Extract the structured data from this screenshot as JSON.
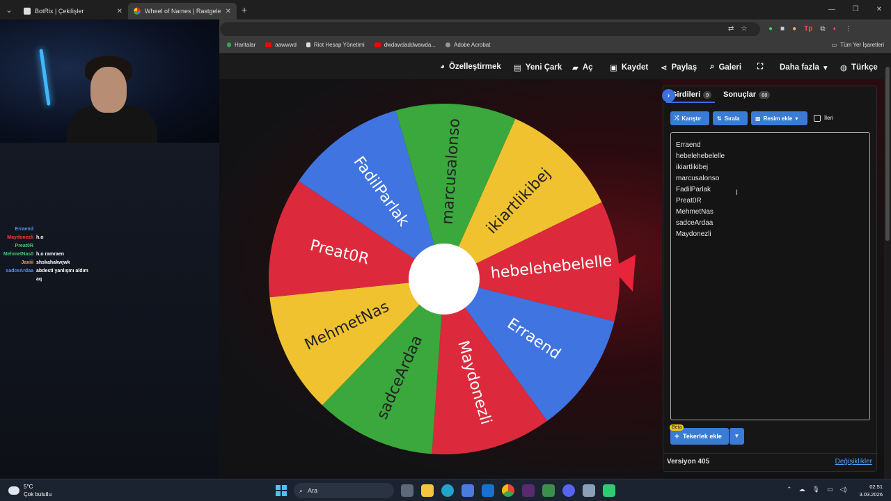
{
  "browser": {
    "tabs": [
      {
        "title": "BotRix | Çekilişler",
        "active": false
      },
      {
        "title": "Wheel of Names | Rastgele ad s",
        "active": true
      }
    ],
    "bookmarks": [
      "Haritalar",
      "aawwwd",
      "Riot Hesap Yönetimi",
      "dwdawdaddwawda...",
      "Adobe Acrobat"
    ],
    "all_bookmarks": "Tüm Yer İşaretleri"
  },
  "nav": {
    "customize": "Özelleştirmek",
    "new_wheel": "Yeni Çark",
    "open": "Aç",
    "save": "Kaydet",
    "share": "Paylaş",
    "gallery": "Galeri",
    "more": "Daha fazla",
    "language": "Türkçe"
  },
  "wheel": {
    "segments": [
      {
        "label": "hebelehebelelle",
        "color": "#dc2a3c"
      },
      {
        "label": "Erraend",
        "color": "#3f74e1"
      },
      {
        "label": "Maydonezli",
        "color": "#dc2a3c"
      },
      {
        "label": "sadceArdaa",
        "color": "#3aa83c"
      },
      {
        "label": "MehmetNas",
        "color": "#f1c230"
      },
      {
        "label": "Preat0R",
        "color": "#dc2a3c"
      },
      {
        "label": "FadilParlak",
        "color": "#3f74e1"
      },
      {
        "label": "marcusalonso",
        "color": "#3aa83c"
      },
      {
        "label": "ikiartlikibej",
        "color": "#f1c230"
      }
    ],
    "pointer_color": "#e8243a"
  },
  "panel": {
    "tab_entries": "Girdileri",
    "tab_entries_count": "9",
    "tab_results": "Sonuçlar",
    "tab_results_count": "60",
    "shuffle": "Karıştır",
    "sort": "Sırala",
    "add_image": "Resim ekle",
    "advanced": "İleri",
    "entries": [
      "Erraend",
      "hebelehebelelle",
      "ikiartlikibej",
      "marcusalonso",
      "FadilParlak",
      "Preat0R",
      "MehmetNas",
      "sadceArdaa",
      "Maydonezli"
    ],
    "beta": "Beta",
    "add_wheels": "Tekerlek ekle",
    "version": "Versiyon 405",
    "changes": "Değişiklikler"
  },
  "chat": [
    {
      "user": "Erraend",
      "msg": "",
      "color": "#5b8dff"
    },
    {
      "user": "Maydonezli",
      "msg": "h.o",
      "color": "#ff3b3b"
    },
    {
      "user": "Preat0R",
      "msg": "",
      "color": "#3bd16f"
    },
    {
      "user": "MehmetNas0",
      "msg": "h.o ramraen",
      "color": "#3bd16f"
    },
    {
      "user": "Jaxiii",
      "msg": "shskahakwjwk",
      "color": "#ff9f43"
    },
    {
      "user": "sadceArdaa",
      "msg": "abdesti yanlışmı aldım",
      "color": "#5b8dff"
    },
    {
      "user": "",
      "msg": "aq",
      "color": "#ffffff"
    }
  ],
  "taskbar": {
    "temp": "5°C",
    "weather": "Çok bulutlu",
    "search": "Ara",
    "time": "02:51",
    "date": "3.03.2026"
  }
}
